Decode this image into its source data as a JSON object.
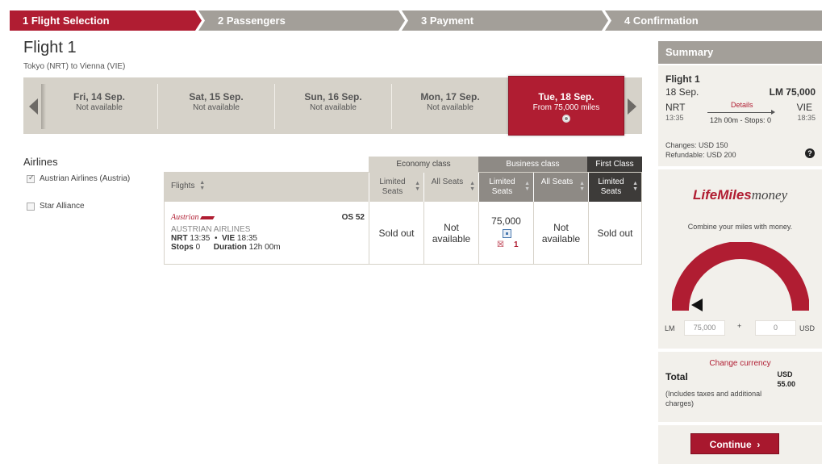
{
  "steps": [
    "1 Flight Selection",
    "2 Passengers",
    "3 Payment",
    "4 Confirmation"
  ],
  "flight": {
    "title": "Flight 1",
    "route": "Tokyo (NRT) to Vienna (VIE)"
  },
  "dates": [
    {
      "label": "Fri, 14 Sep.",
      "sub": "Not available"
    },
    {
      "label": "Sat, 15 Sep.",
      "sub": "Not available"
    },
    {
      "label": "Sun, 16 Sep.",
      "sub": "Not available"
    },
    {
      "label": "Mon, 17 Sep.",
      "sub": "Not available"
    },
    {
      "label": "Tue, 18 Sep.",
      "sub": "From 75,000 miles",
      "selected": true
    }
  ],
  "airlines_filter": {
    "heading": "Airlines",
    "options": [
      {
        "label": "Austrian Airlines (Austria)",
        "checked": true
      },
      {
        "label": "Star Alliance",
        "checked": false
      }
    ]
  },
  "fare_table": {
    "classes": [
      "Economy class",
      "Business class",
      "First Class"
    ],
    "columns": {
      "flights": "Flights",
      "eco_limited": "Limited Seats",
      "eco_all": "All Seats",
      "bus_limited": "Limited Seats",
      "bus_all": "All Seats",
      "first_limited": "Limited Seats"
    },
    "row": {
      "logo_text": "Austrian",
      "flight_no": "OS 52",
      "airline": "AUSTRIAN AIRLINES",
      "origin_code": "NRT",
      "origin_time": "13:35",
      "sep": "•",
      "dest_code": "VIE",
      "dest_time": "18:35",
      "stops_label": "Stops",
      "stops": "0",
      "duration_label": "Duration",
      "duration": "12h 00m",
      "eco_limited": "Sold out",
      "eco_all": "Not available",
      "bus_limited": "75,000",
      "bus_limited_seats": "1",
      "bus_all": "Not available",
      "first_limited": "Sold out"
    }
  },
  "summary": {
    "heading": "Summary",
    "flight_title": "Flight 1",
    "date": "18 Sep.",
    "price": "LM 75,000",
    "origin": "NRT",
    "origin_time": "13:35",
    "dest": "VIE",
    "dest_time": "18:35",
    "details_link": "Details",
    "duration_stops": "12h 00m - Stops: 0",
    "changes": "Changes: USD 150",
    "refundable": "Refundable: USD 200",
    "help": "?"
  },
  "lifemiles": {
    "logo_a": "LifeMiles",
    "logo_b": "money",
    "subtitle": "Combine your miles with money.",
    "lm_label": "LM",
    "lm_value": "75,000",
    "plus": "+",
    "usd_value": "0",
    "usd_label": "USD"
  },
  "total": {
    "change_currency": "Change currency",
    "label": "Total",
    "currency": "USD",
    "amount": "55.00",
    "note": "(Includes taxes and additional charges)"
  },
  "continue_label": "Continue",
  "colors": {
    "brand_red": "#b01d32",
    "grey_step": "#a39f99",
    "beige": "#d6d2c9",
    "dark": "#3d3b39"
  }
}
